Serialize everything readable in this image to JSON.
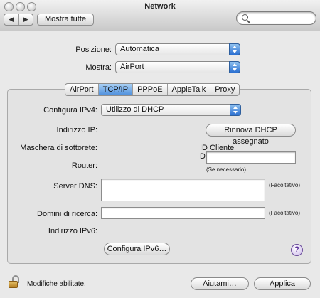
{
  "window": {
    "title": "Network"
  },
  "toolbar": {
    "back_label": "◀",
    "forward_label": "▶",
    "show_all_label": "Mostra tutte",
    "search_placeholder": ""
  },
  "location": {
    "label": "Posizione:",
    "value": "Automatica"
  },
  "show": {
    "label": "Mostra:",
    "value": "AirPort"
  },
  "tabs": [
    {
      "label": "AirPort",
      "active": false
    },
    {
      "label": "TCP/IP",
      "active": true
    },
    {
      "label": "PPPoE",
      "active": false
    },
    {
      "label": "AppleTalk",
      "active": false
    },
    {
      "label": "Proxy",
      "active": false
    }
  ],
  "tcpip": {
    "configure_ipv4_label": "Configura IPv4:",
    "configure_ipv4_value": "Utilizzo di DHCP",
    "ip_address_label": "Indirizzo IP:",
    "renew_dhcp_label": "Rinnova DHCP assegnato",
    "subnet_mask_label": "Maschera di sottorete:",
    "dhcp_client_id_label": "ID Cliente DHCP:",
    "dhcp_client_id_value": "",
    "router_label": "Router:",
    "if_needed_note": "(Se necessario)",
    "dns_servers_label": "Server DNS:",
    "dns_servers_value": "",
    "optional_note_dns": "(Facoltativo)",
    "search_domains_label": "Domini di ricerca:",
    "search_domains_value": "",
    "optional_note_domains": "(Facoltativo)",
    "ipv6_address_label": "Indirizzo IPv6:",
    "configure_ipv6_label": "Configura IPv6…",
    "help_label": "?"
  },
  "footer": {
    "lock_status": "Modifiche abilitate.",
    "help_button": "Aiutami…",
    "apply_button": "Applica"
  }
}
